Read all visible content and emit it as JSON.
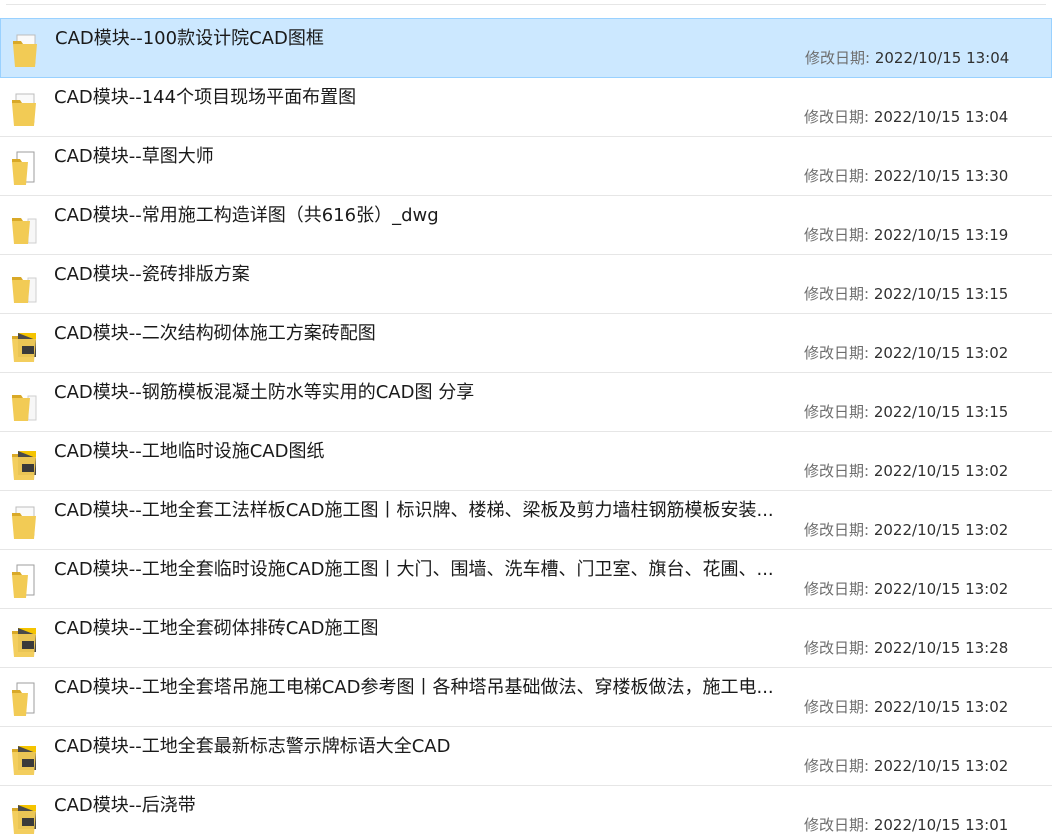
{
  "meta_label": "修改日期:",
  "rows": [
    {
      "name": "CAD模块--100款设计院CAD图框",
      "date": "2022/10/15 13:04",
      "icon": "folder-with-zip-icon",
      "selected": true
    },
    {
      "name": "CAD模块--144个项目现场平面布置图",
      "date": "2022/10/15 13:04",
      "icon": "folder-with-zip-icon",
      "selected": false
    },
    {
      "name": "CAD模块--草图大师",
      "date": "2022/10/15 13:30",
      "icon": "folder-with-document-icon",
      "selected": false
    },
    {
      "name": "CAD模块--常用施工构造详图（共616张）_dwg",
      "date": "2022/10/15 13:19",
      "icon": "folder-icon",
      "selected": false
    },
    {
      "name": "CAD模块--瓷砖排版方案",
      "date": "2022/10/15 13:15",
      "icon": "folder-icon",
      "selected": false
    },
    {
      "name": "CAD模块--二次结构砌体施工方案砖配图",
      "date": "2022/10/15 13:02",
      "icon": "folder-with-dwg-icon",
      "selected": false
    },
    {
      "name": "CAD模块--钢筋模板混凝土防水等实用的CAD图  分享",
      "date": "2022/10/15 13:15",
      "icon": "folder-icon",
      "selected": false
    },
    {
      "name": "CAD模块--工地临时设施CAD图纸",
      "date": "2022/10/15 13:02",
      "icon": "folder-with-dwg-icon",
      "selected": false
    },
    {
      "name": "CAD模块--工地全套工法样板CAD施工图丨标识牌、楼梯、梁板及剪力墙柱钢筋模板安装...",
      "date": "2022/10/15 13:02",
      "icon": "folder-with-zip-icon",
      "selected": false
    },
    {
      "name": "CAD模块--工地全套临时设施CAD施工图丨大门、围墙、洗车槽、门卫室、旗台、花圃、...",
      "date": "2022/10/15 13:02",
      "icon": "folder-with-document-icon",
      "selected": false
    },
    {
      "name": "CAD模块--工地全套砌体排砖CAD施工图",
      "date": "2022/10/15 13:28",
      "icon": "folder-with-dwg-icon",
      "selected": false
    },
    {
      "name": "CAD模块--工地全套塔吊施工电梯CAD参考图丨各种塔吊基础做法、穿楼板做法，施工电...",
      "date": "2022/10/15 13:02",
      "icon": "folder-with-document-icon",
      "selected": false
    },
    {
      "name": "CAD模块--工地全套最新标志警示牌标语大全CAD",
      "date": "2022/10/15 13:02",
      "icon": "folder-with-dwg-icon",
      "selected": false
    },
    {
      "name": "CAD模块--后浇带",
      "date": "2022/10/15 13:01",
      "icon": "folder-with-dwg-icon",
      "selected": false
    }
  ]
}
